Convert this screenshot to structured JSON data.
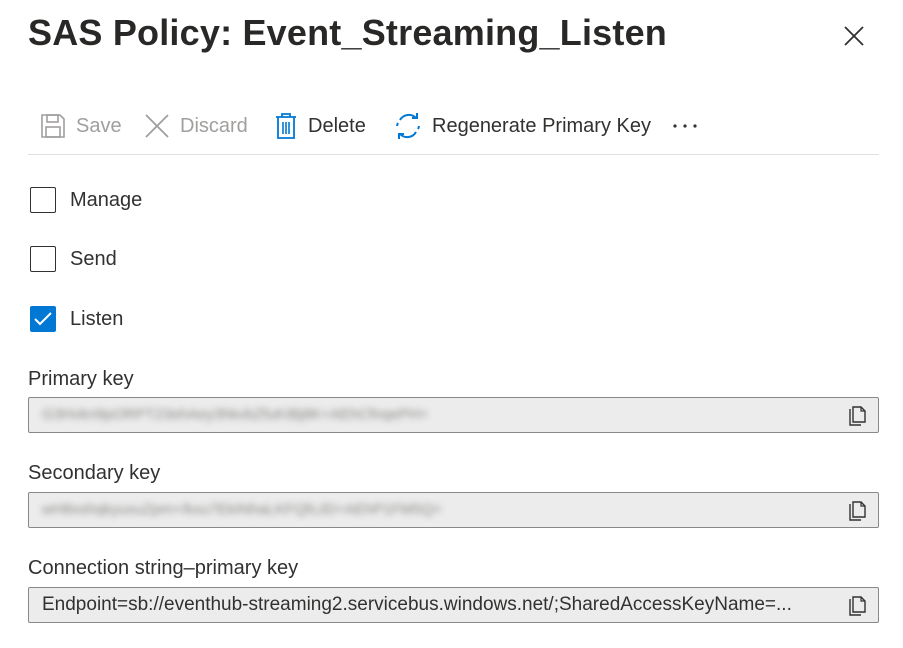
{
  "header": {
    "title": "SAS Policy: Event_Streaming_Listen"
  },
  "toolbar": {
    "save_label": "Save",
    "discard_label": "Discard",
    "delete_label": "Delete",
    "regenerate_label": "Regenerate Primary Key",
    "more_label": "···"
  },
  "claims": [
    {
      "label": "Manage",
      "checked": false
    },
    {
      "label": "Send",
      "checked": false
    },
    {
      "label": "Listen",
      "checked": true
    }
  ],
  "fields": {
    "primary_key": {
      "label": "Primary key",
      "value": "G3Hvkn9pORPT23ehAey3hkvbZfuKIBj8K+AEhCfnqePH="
    },
    "secondary_key": {
      "label": "Secondary key",
      "value": "wH8xshqkyuxuZpm+/kxu7EkINhaLKFQfcJD+AEhP1FM5Q="
    },
    "connection_string_primary": {
      "label": "Connection string–primary key",
      "value": "Endpoint=sb://eventhub-streaming2.servicebus.windows.net/;SharedAccessKeyName=..."
    }
  },
  "colors": {
    "accent": "#0078d4",
    "disabled_text": "#a19f9d",
    "field_bg": "#ececec"
  },
  "icons": [
    "close-icon",
    "save-icon",
    "discard-icon",
    "delete-icon",
    "refresh-icon",
    "more-icon",
    "checkmark-icon",
    "copy-icon"
  ]
}
